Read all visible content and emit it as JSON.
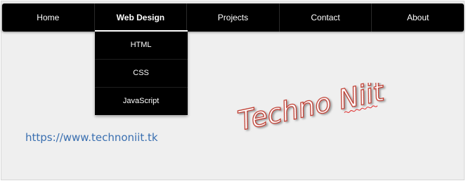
{
  "nav": {
    "items": [
      {
        "label": "Home"
      },
      {
        "label": "Web Design",
        "active": true
      },
      {
        "label": "Projects"
      },
      {
        "label": "Contact"
      },
      {
        "label": "About"
      }
    ],
    "dropdown": {
      "items": [
        {
          "label": "HTML"
        },
        {
          "label": "CSS"
        },
        {
          "label": "JavaScript"
        }
      ]
    }
  },
  "content": {
    "url": "https://www.technoniit.tk"
  },
  "watermark": {
    "text": "Techno Niit"
  },
  "colors": {
    "navbar": "#000000",
    "page_background": "#efefef",
    "link": "#3a6fb0",
    "watermark_outline": "#c0392b"
  }
}
